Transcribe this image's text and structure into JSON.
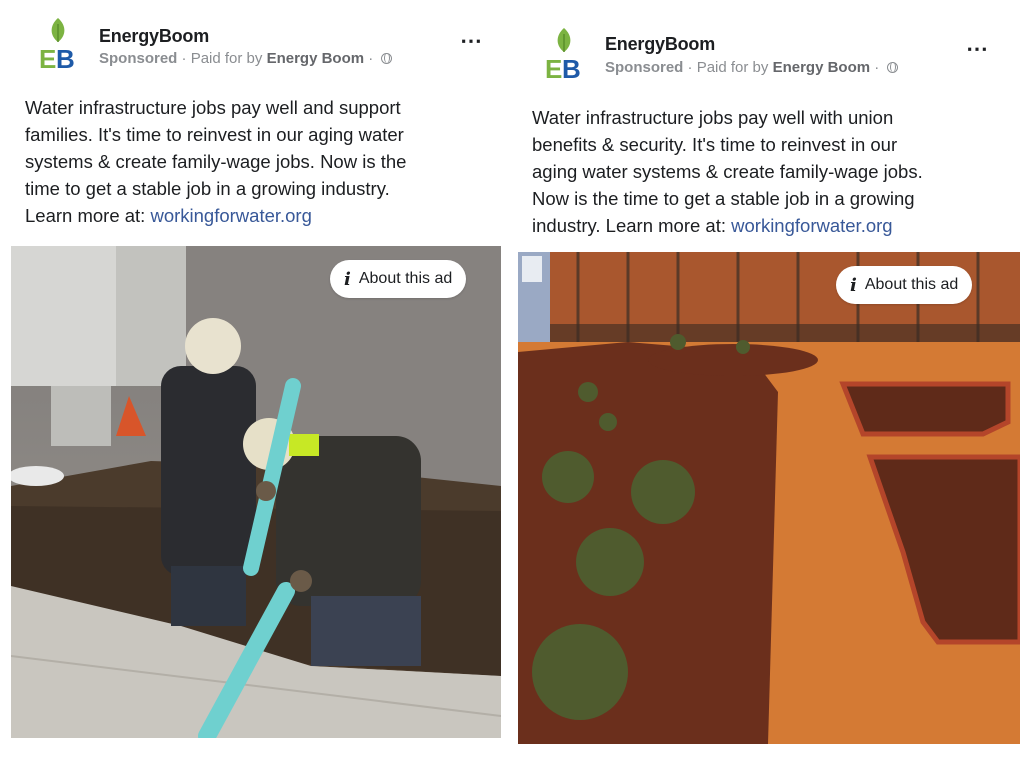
{
  "ads": [
    {
      "advertiser": "EnergyBoom",
      "logo_text": "EB",
      "sponsored": "Sponsored",
      "separator": " · ",
      "paid_for_by": "Paid for by",
      "payer": "Energy Boom",
      "separator2": " · ",
      "more_icon": "⋯",
      "body_lines": [
        "Water infrastructure jobs pay well and support",
        "families. It's time to reinvest in our aging water",
        "systems & create family-wage jobs. Now is the",
        "time to get a stable job in a growing industry."
      ],
      "learn_more": "Learn more at: ",
      "link": "workingforwater.org",
      "about_label": "About this ad",
      "image_subject": "workers-pipe-trench-photo"
    },
    {
      "advertiser": "EnergyBoom",
      "logo_text": "EB",
      "sponsored": "Sponsored",
      "separator": " · ",
      "paid_for_by": "Paid for by",
      "payer": "Energy Boom",
      "separator2": " · ",
      "more_icon": "⋯",
      "body_lines": [
        "Water infrastructure jobs pay well with union",
        "benefits & security. It's time to reinvest in our",
        "aging water systems & create family-wage jobs.",
        "Now is the time to get a stable job in a growing"
      ],
      "learn_more": "industry. Learn more at: ",
      "link": "workingforwater.org",
      "about_label": "About this ad",
      "image_subject": "landscaped-garden-photo"
    }
  ],
  "colors": {
    "link": "#385898",
    "logo_leaf": "#7cb342",
    "logo_e": "#7cb342",
    "logo_b": "#1e5aa8",
    "meta": "#8a8d91"
  }
}
